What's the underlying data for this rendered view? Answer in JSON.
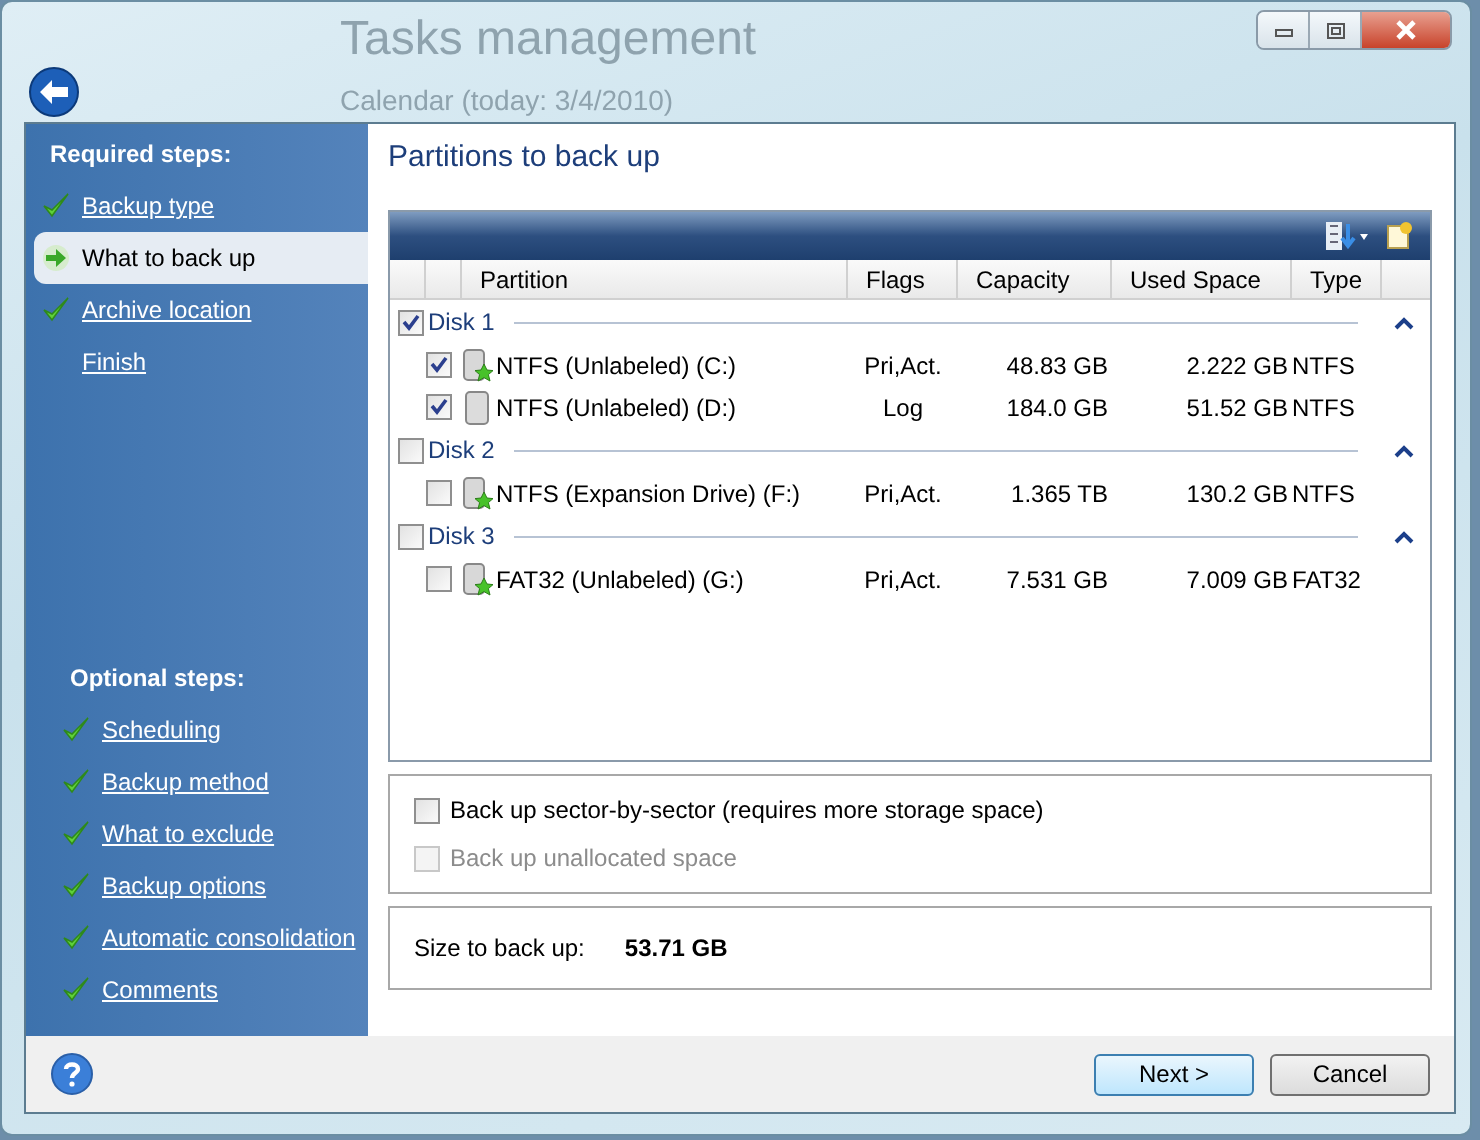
{
  "background_app": {
    "title": "Tasks management",
    "subtitle": "Calendar (today: 3/4/2010)"
  },
  "sidebar": {
    "sections": [
      {
        "heading": "Required steps:",
        "items": [
          {
            "label": "Backup type",
            "completed": true,
            "selected": false
          },
          {
            "label": "What to back up",
            "completed": false,
            "selected": true
          },
          {
            "label": "Archive location",
            "completed": true,
            "selected": false
          },
          {
            "label": "Finish",
            "completed": false,
            "selected": false
          }
        ]
      },
      {
        "heading": "Optional steps:",
        "items": [
          {
            "label": "Scheduling",
            "completed": true,
            "selected": false
          },
          {
            "label": "Backup method",
            "completed": true,
            "selected": false
          },
          {
            "label": "What to exclude",
            "completed": true,
            "selected": false
          },
          {
            "label": "Backup options",
            "completed": true,
            "selected": false
          },
          {
            "label": "Automatic consolidation",
            "completed": true,
            "selected": false
          },
          {
            "label": "Comments",
            "completed": true,
            "selected": false
          }
        ]
      }
    ]
  },
  "main": {
    "title": "Partitions to back up",
    "table": {
      "columns": [
        "Partition",
        "Flags",
        "Capacity",
        "Used Space",
        "Type"
      ],
      "disks": [
        {
          "name": "Disk 1",
          "checked": true,
          "expanded": true,
          "partitions": [
            {
              "name": "NTFS (Unlabeled) (C:)",
              "kind": "primary",
              "checked": true,
              "flags": "Pri,Act.",
              "capacity": "48.83 GB",
              "used": "2.222 GB",
              "type": "NTFS"
            },
            {
              "name": "NTFS (Unlabeled) (D:)",
              "kind": "logical",
              "checked": true,
              "flags": "Log",
              "capacity": "184.0 GB",
              "used": "51.52 GB",
              "type": "NTFS"
            }
          ]
        },
        {
          "name": "Disk 2",
          "checked": false,
          "expanded": true,
          "partitions": [
            {
              "name": "NTFS (Expansion Drive) (F:)",
              "kind": "primary",
              "checked": false,
              "flags": "Pri,Act.",
              "capacity": "1.365 TB",
              "used": "130.2 GB",
              "type": "NTFS"
            }
          ]
        },
        {
          "name": "Disk 3",
          "checked": false,
          "expanded": true,
          "partitions": [
            {
              "name": "FAT32 (Unlabeled) (G:)",
              "kind": "primary",
              "checked": false,
              "flags": "Pri,Act.",
              "capacity": "7.531 GB",
              "used": "7.009 GB",
              "type": "FAT32"
            }
          ]
        }
      ]
    },
    "options": [
      {
        "label": "Back up sector-by-sector (requires more storage space)",
        "checked": false,
        "disabled": false
      },
      {
        "label": "Back up unallocated space",
        "checked": false,
        "disabled": true
      }
    ],
    "size_label": "Size to back up:",
    "size_value": "53.71 GB"
  },
  "buttons": [
    {
      "label": "Next >",
      "kind": "default"
    },
    {
      "label": "Cancel",
      "kind": "normal"
    }
  ]
}
